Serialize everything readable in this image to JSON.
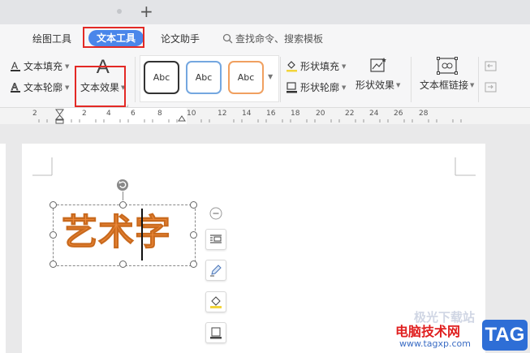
{
  "tabs": [
    {
      "label": "绘图工具"
    },
    {
      "label": "文本工具"
    },
    {
      "label": "论文助手"
    }
  ],
  "search": {
    "label": "查找命令、搜索模板"
  },
  "ribbon": {
    "text_fill": "文本填充",
    "text_outline": "文本轮廓",
    "text_effect": "文本效果",
    "text_effect_glyph": "A",
    "styles": [
      "Abc",
      "Abc",
      "Abc"
    ],
    "shape_fill": "形状填充",
    "shape_outline": "形状轮廓",
    "shape_effect": "形状效果",
    "textbox_link": "文本框链接"
  },
  "ruler": {
    "numbers": [
      "2",
      "2",
      "4",
      "6",
      "8",
      "10",
      "12",
      "14",
      "16",
      "18",
      "20",
      "22",
      "24",
      "26",
      "28"
    ]
  },
  "document": {
    "art_text": "艺术字"
  },
  "watermark": {
    "site": "电脑技术网",
    "url": "www.tagxp.com",
    "tag": "TAG",
    "faint": "极光下载站"
  },
  "colors": {
    "accent": "#4a86ea",
    "highlight": "#e32925",
    "art_orange": "#f08a3a",
    "style_blue": "#74a7e0",
    "style_orange": "#f0a060"
  }
}
